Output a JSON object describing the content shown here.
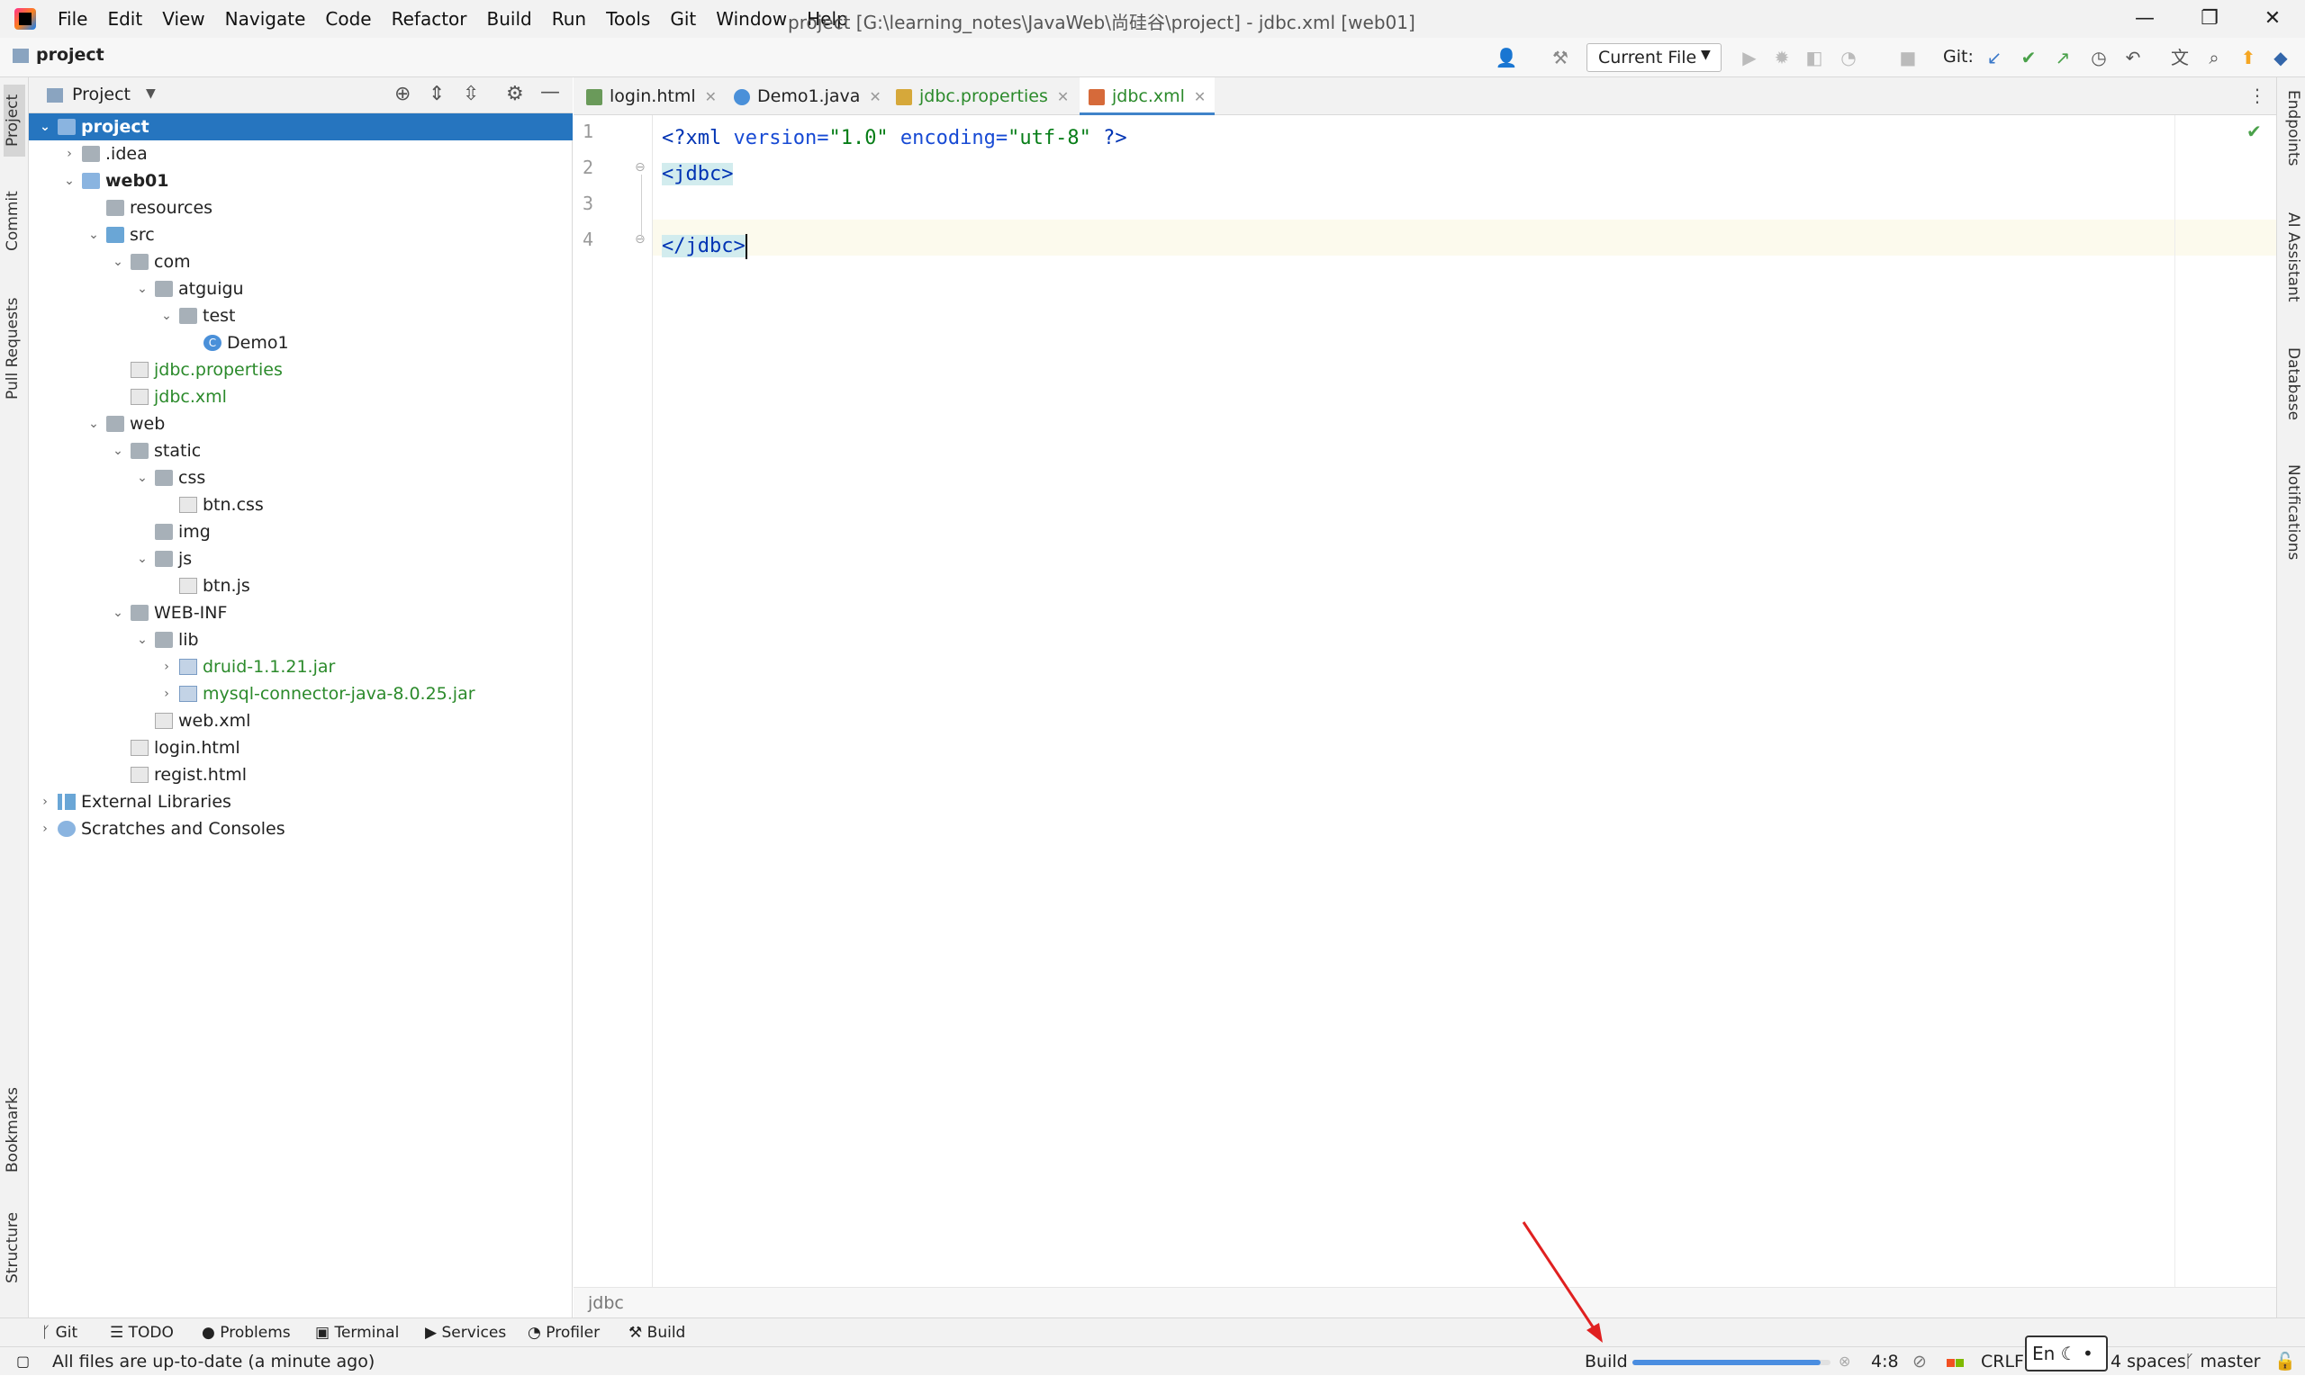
{
  "menubar": {
    "items": [
      "File",
      "Edit",
      "View",
      "Navigate",
      "Code",
      "Refactor",
      "Build",
      "Run",
      "Tools",
      "Git",
      "Window",
      "Help"
    ],
    "window_title": "project [G:\\learning_notes\\JavaWeb\\尚硅谷\\project] - jdbc.xml [web01]"
  },
  "navbar": {
    "project": "project",
    "run_config": "Current File",
    "git_label": "Git:"
  },
  "left_tabs": [
    "Project",
    "Commit",
    "Pull Requests",
    "Bookmarks",
    "Structure"
  ],
  "right_tabs": [
    "Endpoints",
    "AI Assistant",
    "Database",
    "Notifications"
  ],
  "project_panel": {
    "title": "Project"
  },
  "tree": [
    {
      "label": "project",
      "depth": 0,
      "chev": "v",
      "icon": "mod",
      "sel": true
    },
    {
      "label": ".idea",
      "depth": 1,
      "chev": ">",
      "icon": "folder"
    },
    {
      "label": "web01",
      "depth": 1,
      "chev": "v",
      "icon": "mod",
      "bold": true
    },
    {
      "label": "resources",
      "depth": 2,
      "chev": "",
      "icon": "folder"
    },
    {
      "label": "src",
      "depth": 2,
      "chev": "v",
      "icon": "blue"
    },
    {
      "label": "com",
      "depth": 3,
      "chev": "v",
      "icon": "folder"
    },
    {
      "label": "atguigu",
      "depth": 4,
      "chev": "v",
      "icon": "folder"
    },
    {
      "label": "test",
      "depth": 5,
      "chev": "v",
      "icon": "folder"
    },
    {
      "label": "Demo1",
      "depth": 6,
      "chev": "",
      "icon": "java"
    },
    {
      "label": "jdbc.properties",
      "depth": 3,
      "chev": "",
      "icon": "file",
      "green": true
    },
    {
      "label": "jdbc.xml",
      "depth": 3,
      "chev": "",
      "icon": "file",
      "green": true
    },
    {
      "label": "web",
      "depth": 2,
      "chev": "v",
      "icon": "folder"
    },
    {
      "label": "static",
      "depth": 3,
      "chev": "v",
      "icon": "folder"
    },
    {
      "label": "css",
      "depth": 4,
      "chev": "v",
      "icon": "folder"
    },
    {
      "label": "btn.css",
      "depth": 5,
      "chev": "",
      "icon": "file"
    },
    {
      "label": "img",
      "depth": 4,
      "chev": "",
      "icon": "folder"
    },
    {
      "label": "js",
      "depth": 4,
      "chev": "v",
      "icon": "folder"
    },
    {
      "label": "btn.js",
      "depth": 5,
      "chev": "",
      "icon": "file"
    },
    {
      "label": "WEB-INF",
      "depth": 3,
      "chev": "v",
      "icon": "folder"
    },
    {
      "label": "lib",
      "depth": 4,
      "chev": "v",
      "icon": "folder"
    },
    {
      "label": "druid-1.1.21.jar",
      "depth": 5,
      "chev": ">",
      "icon": "jar",
      "green": true
    },
    {
      "label": "mysql-connector-java-8.0.25.jar",
      "depth": 5,
      "chev": ">",
      "icon": "jar",
      "green": true
    },
    {
      "label": "web.xml",
      "depth": 4,
      "chev": "",
      "icon": "file"
    },
    {
      "label": "login.html",
      "depth": 3,
      "chev": "",
      "icon": "file"
    },
    {
      "label": "regist.html",
      "depth": 3,
      "chev": "",
      "icon": "file"
    },
    {
      "label": "External Libraries",
      "depth": 0,
      "chev": ">",
      "icon": "lib"
    },
    {
      "label": "Scratches and Consoles",
      "depth": 0,
      "chev": ">",
      "icon": "scratch"
    }
  ],
  "editor_tabs": [
    {
      "label": "login.html",
      "color": "#6a9a5a"
    },
    {
      "label": "Demo1.java",
      "color": "#4a90d9"
    },
    {
      "label": "jdbc.properties",
      "color": "#d6a83a"
    },
    {
      "label": "jdbc.xml",
      "color": "#d66a3a"
    }
  ],
  "code": {
    "line_numbers": [
      "1",
      "2",
      "3",
      "4"
    ],
    "l1_open": "<?",
    "l1_xml": "xml ",
    "l1_attr1": "version=",
    "l1_val1": "\"1.0\"",
    "l1_attr2": " encoding=",
    "l1_val2": "\"utf-8\"",
    "l1_close": " ?>",
    "l2": "<jdbc>",
    "l4": "</jdbc>"
  },
  "breadcrumb": "jdbc",
  "tool_windows": [
    "Git",
    "TODO",
    "Problems",
    "Terminal",
    "Services",
    "Profiler",
    "Build"
  ],
  "status": {
    "message": "All files are up-to-date (a minute ago)",
    "build": "Build",
    "position": "4:8",
    "line_sep": "CRLF",
    "indent": "4 spaces",
    "branch": "master",
    "progress": 0.95
  },
  "ime": {
    "label": "En"
  },
  "colors": {
    "accent": "#2675bf",
    "tag": "#0033b3",
    "attr": "#174ad4",
    "string": "#067d17"
  }
}
